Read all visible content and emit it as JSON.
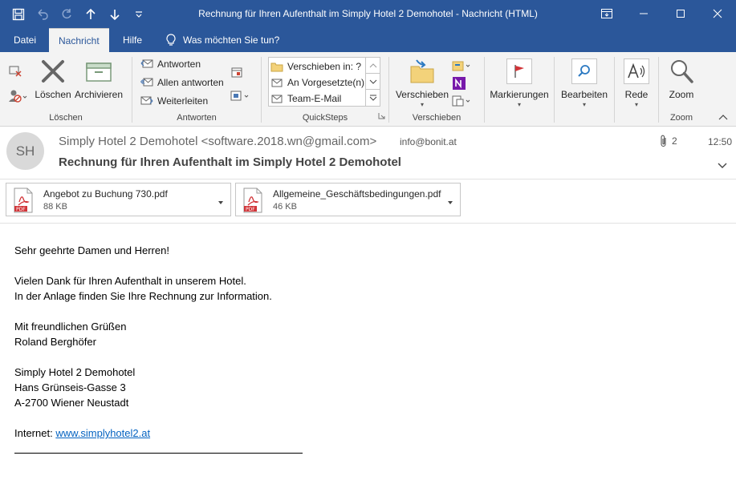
{
  "window": {
    "title": "Rechnung für Ihren Aufenthalt im Simply Hotel 2 Demohotel  -  Nachricht (HTML)"
  },
  "tabs": {
    "file": "Datei",
    "message": "Nachricht",
    "help": "Hilfe",
    "tell_me": "Was möchten Sie tun?"
  },
  "ribbon": {
    "delete_group": {
      "delete_label": "Löschen",
      "archive_label": "Archivieren",
      "group_label": "Löschen"
    },
    "respond_group": {
      "reply": "Antworten",
      "reply_all": "Allen antworten",
      "forward": "Weiterleiten",
      "group_label": "Antworten"
    },
    "quicksteps": {
      "items": [
        "Verschieben in: ?",
        "An Vorgesetzte(n)",
        "Team-E-Mail"
      ],
      "group_label": "QuickSteps"
    },
    "move_group": {
      "move_label": "Verschieben",
      "group_label": "Verschieben"
    },
    "tags": {
      "mark_label": "Markierungen"
    },
    "edit": {
      "edit_label": "Bearbeiten"
    },
    "speech": {
      "speech_label": "Rede"
    },
    "zoom": {
      "zoom_label": "Zoom",
      "group_label": "Zoom"
    }
  },
  "header": {
    "avatar_initials": "SH",
    "sender": "Simply Hotel 2 Demohotel <software.2018.wn@gmail.com>",
    "to": "info@bonit.at",
    "attachment_count": "2",
    "time": "12:50",
    "subject": "Rechnung für Ihren Aufenthalt im Simply Hotel 2 Demohotel"
  },
  "attachments": [
    {
      "name": "Angebot  zu Buchung 730.pdf",
      "size": "88 KB"
    },
    {
      "name": "Allgemeine_Geschäftsbedingungen.pdf",
      "size": "46 KB"
    }
  ],
  "body": {
    "greeting": "Sehr geehrte Damen und Herren!",
    "line1": "Vielen Dank für Ihren Aufenthalt in unserem Hotel.",
    "line2": "In der Anlage finden Sie Ihre Rechnung zur Information.",
    "closing": "Mit freundlichen Grüßen",
    "signature_name": "Roland Berghöfer",
    "company": "Simply Hotel 2 Demohotel",
    "street": "Hans Grünseis-Gasse 3",
    "city": "A-2700 Wiener Neustadt",
    "internet_label": "Internet: ",
    "internet_link": "www.simplyhotel2.at"
  },
  "colors": {
    "title_bar": "#2b579a",
    "ribbon_bg": "#f3f3f3",
    "link": "#0563c1",
    "pdf_red": "#d13438"
  }
}
